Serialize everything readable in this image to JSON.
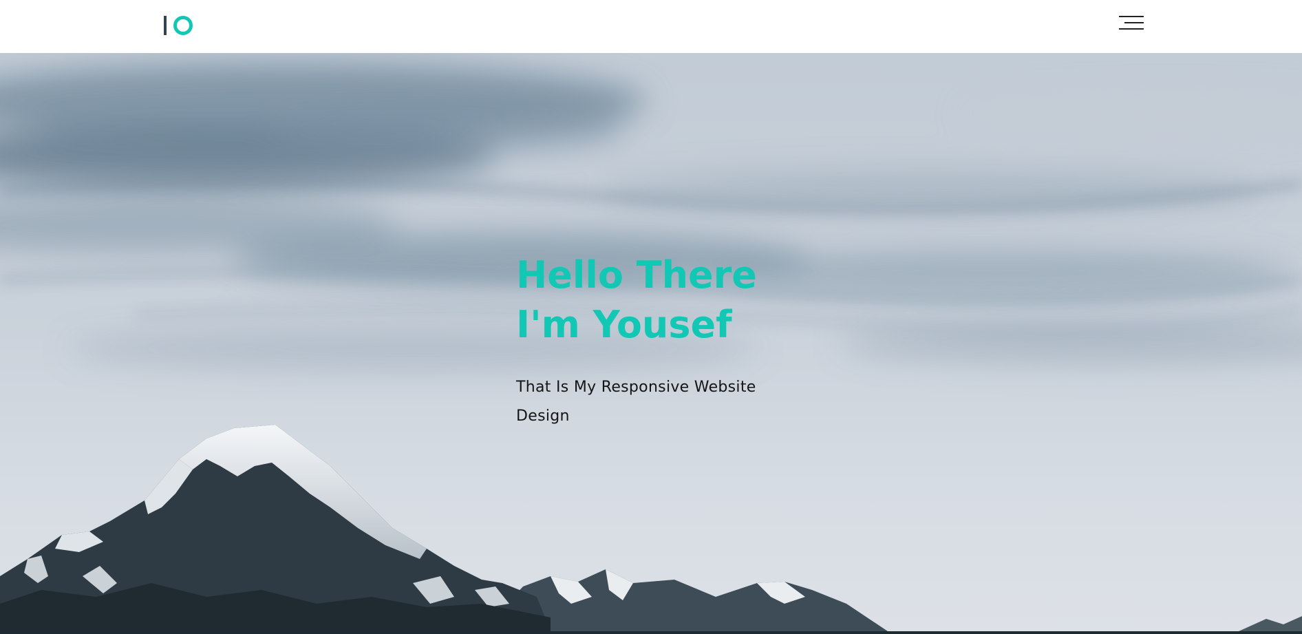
{
  "header": {
    "logo": {
      "bar_color": "#2f4450",
      "ring_color": "#12c7b4"
    },
    "menu_icon": "hamburger-menu-icon"
  },
  "hero": {
    "title_line_1": "Hello There",
    "title_line_2": "I'm Yousef",
    "subtitle": "That Is My Responsive Website Design",
    "title_color": "#12c7b4",
    "background_image": "snowy-mountain-landscape"
  }
}
